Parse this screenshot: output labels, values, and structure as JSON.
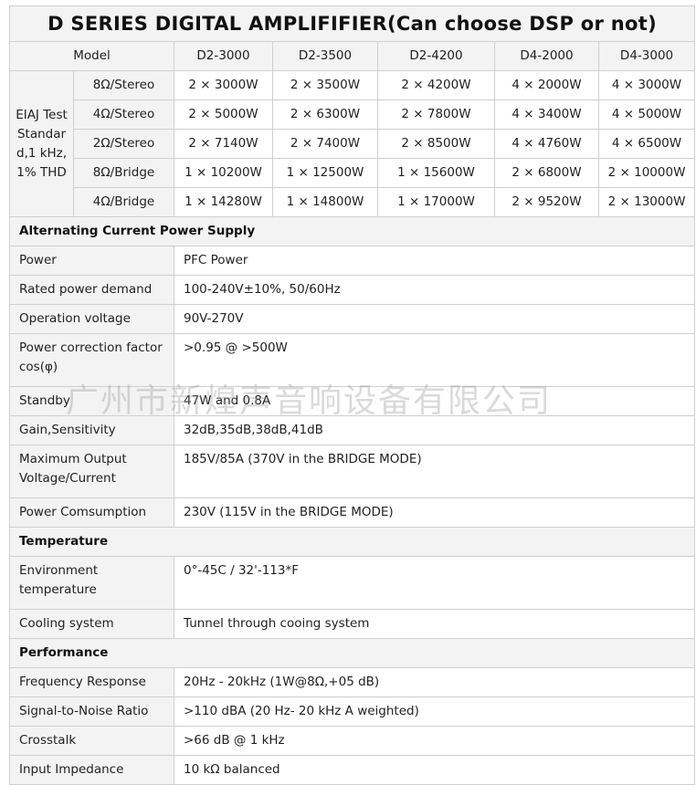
{
  "title": "D SERIES DIGITAL AMPLIFIFIER(Can choose DSP or not)",
  "header": {
    "model_label": "Model",
    "models": [
      "D2-3000",
      "D2-3500",
      "D2-4200",
      "D4-2000",
      "D4-3000"
    ]
  },
  "eiaj_label": "EIAJ Test Standar d,1 kHz, 1% THD",
  "power_rows": [
    {
      "mode": "8Ω/Stereo",
      "values": [
        "2 × 3000W",
        "2 × 3500W",
        "2 × 4200W",
        "4 × 2000W",
        "4 × 3000W"
      ]
    },
    {
      "mode": "4Ω/Stereo",
      "values": [
        "2 × 5000W",
        "2 × 6300W",
        "2 × 7800W",
        "4 × 3400W",
        "4 × 5000W"
      ]
    },
    {
      "mode": "2Ω/Stereo",
      "values": [
        "2 × 7140W",
        "2 × 7400W",
        "2 × 8500W",
        "4 × 4760W",
        "4 × 6500W"
      ]
    },
    {
      "mode": "8Ω/Bridge",
      "values": [
        "1 × 10200W",
        "1 × 12500W",
        "1 × 15600W",
        "2 × 6800W",
        "2 × 10000W"
      ]
    },
    {
      "mode": "4Ω/Bridge",
      "values": [
        "1 × 14280W",
        "1 × 14800W",
        "1 × 17000W",
        "2 × 9520W",
        "2 × 13000W"
      ]
    }
  ],
  "sections": {
    "ac": {
      "title": "Alternating Current Power Supply",
      "rows": [
        {
          "label": "Power",
          "value": "PFC Power"
        },
        {
          "label": "Rated power demand",
          "value": "100-240V±10%, 50/60Hz"
        },
        {
          "label": "Operation voltage",
          "value": "90V-270V"
        },
        {
          "label": "Power correction factor cos(φ)",
          "value": ">0.95 @ >500W"
        },
        {
          "label": "Standby",
          "value": "47W and 0.8A"
        },
        {
          "label": "Gain,Sensitivity",
          "value": "32dB,35dB,38dB,41dB"
        },
        {
          "label": "Maximum Output Voltage/Current",
          "value": "185V/85A (370V in the BRIDGE MODE)"
        },
        {
          "label": "Power Comsumption",
          "value": "230V (115V in the BRIDGE MODE)"
        }
      ]
    },
    "temp": {
      "title": "Temperature",
      "rows": [
        {
          "label": "Environment temperature",
          "value": "0°-45C / 32'-113*F"
        },
        {
          "label": "Cooling system",
          "value": "Tunnel through cooing system"
        }
      ]
    },
    "perf": {
      "title": "Performance",
      "rows": [
        {
          "label": "Frequency Response",
          "value": "20Hz - 20kHz (1W@8Ω,+05 dB)"
        },
        {
          "label": "Signal-to-Noise Ratio",
          "value": ">110 dBA (20 Hz- 20 kHz A weighted)"
        },
        {
          "label": "Crosstalk",
          "value": ">66 dB @ 1 kHz"
        },
        {
          "label": "Input Impedance",
          "value": "10 kΩ balanced"
        }
      ]
    }
  },
  "watermark": "广州市新煌声音响设备有限公司"
}
